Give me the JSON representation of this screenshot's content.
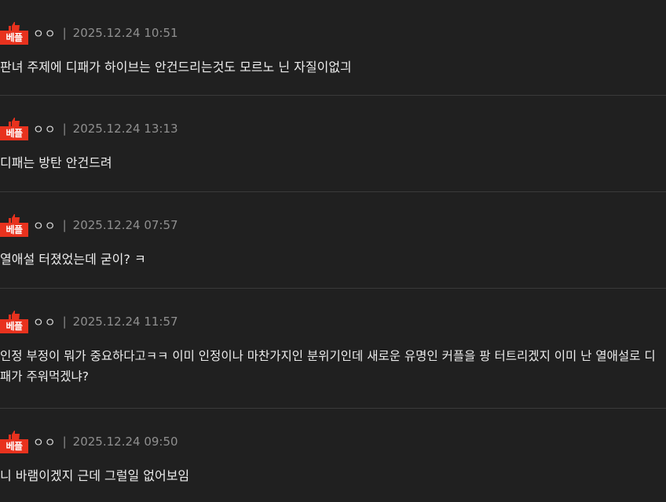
{
  "comments": [
    {
      "badge": "베플",
      "nick": "ㅇㅇ",
      "sep": "|",
      "date": "2025.12.24 10:51",
      "text": "판녀 주제에 디패가 하이브는 안건드리는것도 모르노 닌 자질이없긔"
    },
    {
      "badge": "베플",
      "nick": "ㅇㅇ",
      "sep": "|",
      "date": "2025.12.24 13:13",
      "text": "디패는 방탄 안건드려"
    },
    {
      "badge": "베플",
      "nick": "ㅇㅇ",
      "sep": "|",
      "date": "2025.12.24 07:57",
      "text": "열애설 터졌었는데 굳이? ㅋ"
    },
    {
      "badge": "베플",
      "nick": "ㅇㅇ",
      "sep": "|",
      "date": "2025.12.24 11:57",
      "text": "인정 부정이 뭐가 중요하다고ㅋㅋ 이미 인정이나 마찬가지인 분위기인데 새로운 유명인 커플을 팡 터트리겠지 이미 난 열애설로 디패가 주워먹겠냐?"
    },
    {
      "badge": "베플",
      "nick": "ㅇㅇ",
      "sep": "|",
      "date": "2025.12.24 09:50",
      "text": "니 바램이겠지 근데 그럴일 없어보임"
    }
  ],
  "colors": {
    "badge": "#e8321e",
    "background": "#202020",
    "divider": "#3a3a3a"
  },
  "icons": {
    "badge_icon": "thumbs-up-icon"
  }
}
